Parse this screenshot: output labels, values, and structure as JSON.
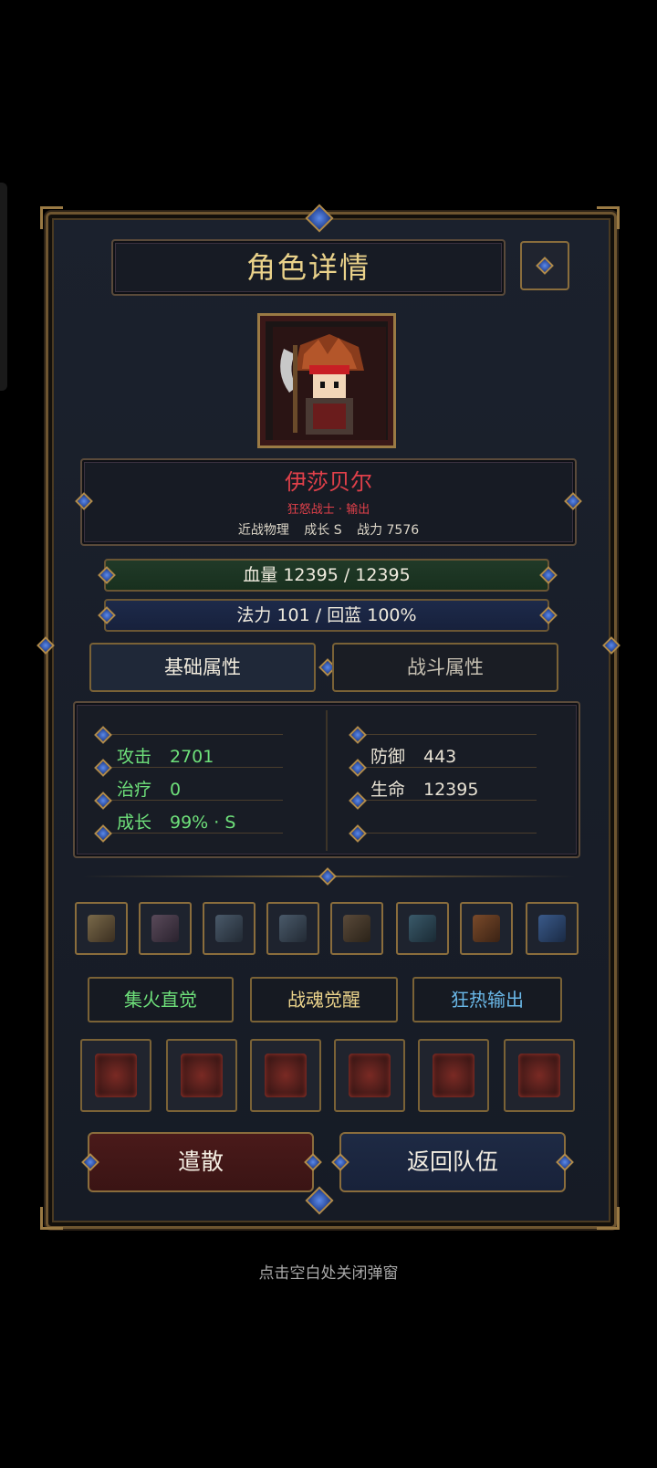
{
  "dialog": {
    "title": "角色详情",
    "hero": {
      "name": "伊莎贝尔",
      "class_role": "狂怒战士 · 输出",
      "type": "近战物理",
      "growth": "成长 S",
      "power": "战力 7576"
    },
    "hp_bar": {
      "text": "血量 12395 / 12395",
      "fill": 1.0
    },
    "mp_bar": {
      "text": "法力 101 / 回蓝 100%"
    },
    "tabs": [
      {
        "label": "基础属性",
        "active": true
      },
      {
        "label": "战斗属性",
        "active": false
      }
    ],
    "attributes_left": [
      {
        "label": "攻击",
        "value": "2701"
      },
      {
        "label": "治疗",
        "value": "0"
      },
      {
        "label": "成长",
        "value": "99% · S"
      }
    ],
    "attributes_right": [
      {
        "label": "防御",
        "value": "443"
      },
      {
        "label": "生命",
        "value": "12395"
      }
    ],
    "equipment_slots": [
      "sword-icon",
      "chest-armor-icon",
      "helmet-icon",
      "gauntlet-icon",
      "leg-armor-icon",
      "belt-icon",
      "ring-icon",
      "amulet-icon"
    ],
    "skill_tags": [
      {
        "label": "集火直觉",
        "color": "#6ee07a"
      },
      {
        "label": "战魂觉醒",
        "color": "#ead28a"
      },
      {
        "label": "狂热输出",
        "color": "#6ab8e8"
      }
    ],
    "skills": [
      "axe-strike-icon",
      "cross-slash-icon",
      "spartan-helmet-icon",
      "whirlwind-icon",
      "blood-rage-icon",
      "berserker-icon"
    ],
    "buttons": {
      "dismiss": "遣散",
      "return": "返回队伍"
    },
    "close_hint": "点击空白处关闭弹窗"
  }
}
